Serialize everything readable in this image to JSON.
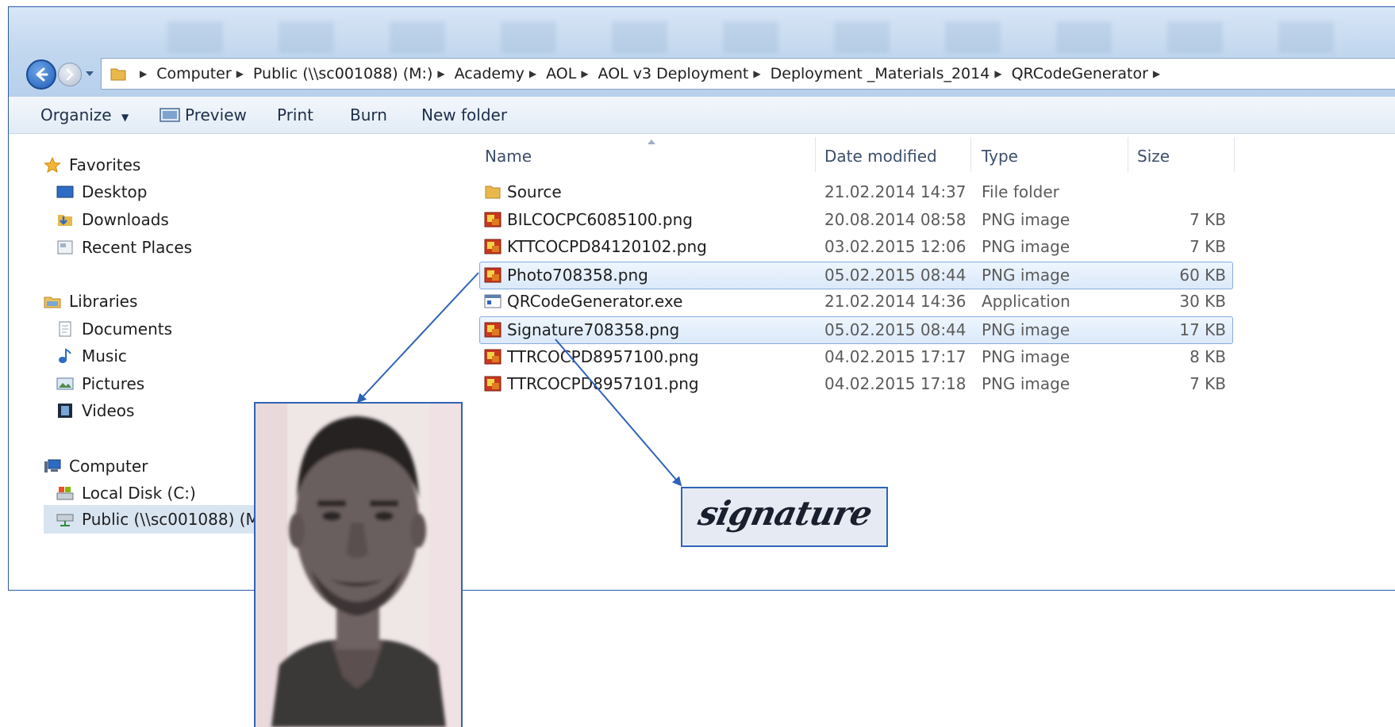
{
  "breadcrumb": [
    "Computer",
    "Public (\\\\sc001088) (M:)",
    "Academy",
    "AOL",
    "AOL v3 Deployment",
    "Deployment _Materials_2014",
    "QRCodeGenerator"
  ],
  "toolbar": {
    "organize": "Organize",
    "preview": "Preview",
    "print": "Print",
    "burn": "Burn",
    "new_folder": "New folder"
  },
  "nav": {
    "favorites": "Favorites",
    "desktop": "Desktop",
    "downloads": "Downloads",
    "recent": "Recent Places",
    "libraries": "Libraries",
    "documents": "Documents",
    "music": "Music",
    "pictures": "Pictures",
    "videos": "Videos",
    "computer": "Computer",
    "local_disk": "Local Disk (C:)",
    "public": "Public (\\\\sc001088) (M:)"
  },
  "columns": {
    "name": "Name",
    "date": "Date modified",
    "type": "Type",
    "size": "Size"
  },
  "files": [
    {
      "name": "Source",
      "date": "21.02.2014 14:37",
      "type": "File folder",
      "size": "",
      "icon": "folder-icon",
      "selected": false
    },
    {
      "name": "BILCOCPC6085100.png",
      "date": "20.08.2014 08:58",
      "type": "PNG image",
      "size": "7 KB",
      "icon": "png-icon",
      "selected": false
    },
    {
      "name": "KTTCOCPD84120102.png",
      "date": "03.02.2015 12:06",
      "type": "PNG image",
      "size": "7 KB",
      "icon": "png-icon",
      "selected": false
    },
    {
      "name": "Photo708358.png",
      "date": "05.02.2015 08:44",
      "type": "PNG image",
      "size": "60 KB",
      "icon": "png-icon",
      "selected": true
    },
    {
      "name": "QRCodeGenerator.exe",
      "date": "21.02.2014 14:36",
      "type": "Application",
      "size": "30 KB",
      "icon": "exe-icon",
      "selected": false
    },
    {
      "name": "Signature708358.png",
      "date": "05.02.2015 08:44",
      "type": "PNG image",
      "size": "17 KB",
      "icon": "png-icon",
      "selected": true
    },
    {
      "name": "TTRCOCPD8957100.png",
      "date": "04.02.2015 17:17",
      "type": "PNG image",
      "size": "8 KB",
      "icon": "png-icon",
      "selected": false
    },
    {
      "name": "TTRCOCPD8957101.png",
      "date": "04.02.2015 17:18",
      "type": "PNG image",
      "size": "7 KB",
      "icon": "png-icon",
      "selected": false
    }
  ],
  "callouts": {
    "signature_text": "signature"
  },
  "colors": {
    "accent": "#2f63b8",
    "selection": "#dbe9fa",
    "selection_border": "#84acdd"
  }
}
